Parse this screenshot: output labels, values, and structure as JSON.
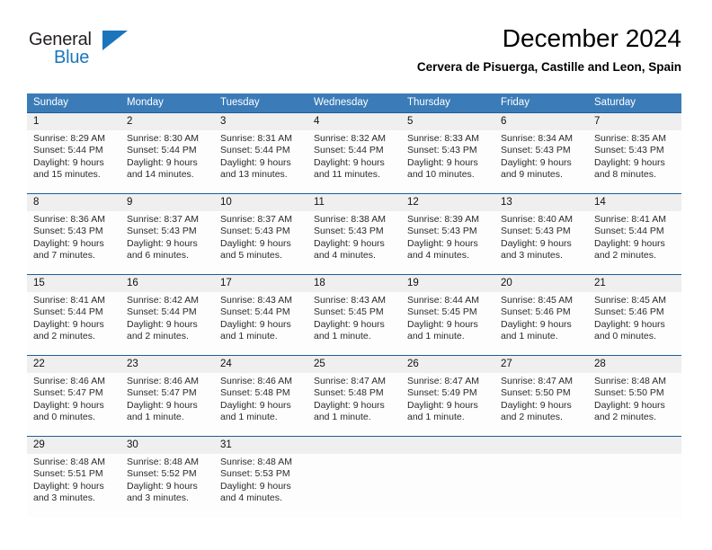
{
  "brand": {
    "name_part1": "General",
    "name_part2": "Blue",
    "flag_icon": "triangle-flag-icon",
    "accent_color": "#1b75bb"
  },
  "header": {
    "title": "December 2024",
    "subtitle": "Cervera de Pisuerga, Castille and Leon, Spain"
  },
  "theme": {
    "header_row_color": "#3b7cb8",
    "row_divider_color": "#1b5e9e",
    "daynum_band_color": "#efefef"
  },
  "calendar": {
    "weekday_headers": [
      "Sunday",
      "Monday",
      "Tuesday",
      "Wednesday",
      "Thursday",
      "Friday",
      "Saturday"
    ],
    "weeks": [
      [
        {
          "day": "1",
          "sunrise": "Sunrise: 8:29 AM",
          "sunset": "Sunset: 5:44 PM",
          "daylight_line1": "Daylight: 9 hours",
          "daylight_line2": "and 15 minutes."
        },
        {
          "day": "2",
          "sunrise": "Sunrise: 8:30 AM",
          "sunset": "Sunset: 5:44 PM",
          "daylight_line1": "Daylight: 9 hours",
          "daylight_line2": "and 14 minutes."
        },
        {
          "day": "3",
          "sunrise": "Sunrise: 8:31 AM",
          "sunset": "Sunset: 5:44 PM",
          "daylight_line1": "Daylight: 9 hours",
          "daylight_line2": "and 13 minutes."
        },
        {
          "day": "4",
          "sunrise": "Sunrise: 8:32 AM",
          "sunset": "Sunset: 5:44 PM",
          "daylight_line1": "Daylight: 9 hours",
          "daylight_line2": "and 11 minutes."
        },
        {
          "day": "5",
          "sunrise": "Sunrise: 8:33 AM",
          "sunset": "Sunset: 5:43 PM",
          "daylight_line1": "Daylight: 9 hours",
          "daylight_line2": "and 10 minutes."
        },
        {
          "day": "6",
          "sunrise": "Sunrise: 8:34 AM",
          "sunset": "Sunset: 5:43 PM",
          "daylight_line1": "Daylight: 9 hours",
          "daylight_line2": "and 9 minutes."
        },
        {
          "day": "7",
          "sunrise": "Sunrise: 8:35 AM",
          "sunset": "Sunset: 5:43 PM",
          "daylight_line1": "Daylight: 9 hours",
          "daylight_line2": "and 8 minutes."
        }
      ],
      [
        {
          "day": "8",
          "sunrise": "Sunrise: 8:36 AM",
          "sunset": "Sunset: 5:43 PM",
          "daylight_line1": "Daylight: 9 hours",
          "daylight_line2": "and 7 minutes."
        },
        {
          "day": "9",
          "sunrise": "Sunrise: 8:37 AM",
          "sunset": "Sunset: 5:43 PM",
          "daylight_line1": "Daylight: 9 hours",
          "daylight_line2": "and 6 minutes."
        },
        {
          "day": "10",
          "sunrise": "Sunrise: 8:37 AM",
          "sunset": "Sunset: 5:43 PM",
          "daylight_line1": "Daylight: 9 hours",
          "daylight_line2": "and 5 minutes."
        },
        {
          "day": "11",
          "sunrise": "Sunrise: 8:38 AM",
          "sunset": "Sunset: 5:43 PM",
          "daylight_line1": "Daylight: 9 hours",
          "daylight_line2": "and 4 minutes."
        },
        {
          "day": "12",
          "sunrise": "Sunrise: 8:39 AM",
          "sunset": "Sunset: 5:43 PM",
          "daylight_line1": "Daylight: 9 hours",
          "daylight_line2": "and 4 minutes."
        },
        {
          "day": "13",
          "sunrise": "Sunrise: 8:40 AM",
          "sunset": "Sunset: 5:43 PM",
          "daylight_line1": "Daylight: 9 hours",
          "daylight_line2": "and 3 minutes."
        },
        {
          "day": "14",
          "sunrise": "Sunrise: 8:41 AM",
          "sunset": "Sunset: 5:44 PM",
          "daylight_line1": "Daylight: 9 hours",
          "daylight_line2": "and 2 minutes."
        }
      ],
      [
        {
          "day": "15",
          "sunrise": "Sunrise: 8:41 AM",
          "sunset": "Sunset: 5:44 PM",
          "daylight_line1": "Daylight: 9 hours",
          "daylight_line2": "and 2 minutes."
        },
        {
          "day": "16",
          "sunrise": "Sunrise: 8:42 AM",
          "sunset": "Sunset: 5:44 PM",
          "daylight_line1": "Daylight: 9 hours",
          "daylight_line2": "and 2 minutes."
        },
        {
          "day": "17",
          "sunrise": "Sunrise: 8:43 AM",
          "sunset": "Sunset: 5:44 PM",
          "daylight_line1": "Daylight: 9 hours",
          "daylight_line2": "and 1 minute."
        },
        {
          "day": "18",
          "sunrise": "Sunrise: 8:43 AM",
          "sunset": "Sunset: 5:45 PM",
          "daylight_line1": "Daylight: 9 hours",
          "daylight_line2": "and 1 minute."
        },
        {
          "day": "19",
          "sunrise": "Sunrise: 8:44 AM",
          "sunset": "Sunset: 5:45 PM",
          "daylight_line1": "Daylight: 9 hours",
          "daylight_line2": "and 1 minute."
        },
        {
          "day": "20",
          "sunrise": "Sunrise: 8:45 AM",
          "sunset": "Sunset: 5:46 PM",
          "daylight_line1": "Daylight: 9 hours",
          "daylight_line2": "and 1 minute."
        },
        {
          "day": "21",
          "sunrise": "Sunrise: 8:45 AM",
          "sunset": "Sunset: 5:46 PM",
          "daylight_line1": "Daylight: 9 hours",
          "daylight_line2": "and 0 minutes."
        }
      ],
      [
        {
          "day": "22",
          "sunrise": "Sunrise: 8:46 AM",
          "sunset": "Sunset: 5:47 PM",
          "daylight_line1": "Daylight: 9 hours",
          "daylight_line2": "and 0 minutes."
        },
        {
          "day": "23",
          "sunrise": "Sunrise: 8:46 AM",
          "sunset": "Sunset: 5:47 PM",
          "daylight_line1": "Daylight: 9 hours",
          "daylight_line2": "and 1 minute."
        },
        {
          "day": "24",
          "sunrise": "Sunrise: 8:46 AM",
          "sunset": "Sunset: 5:48 PM",
          "daylight_line1": "Daylight: 9 hours",
          "daylight_line2": "and 1 minute."
        },
        {
          "day": "25",
          "sunrise": "Sunrise: 8:47 AM",
          "sunset": "Sunset: 5:48 PM",
          "daylight_line1": "Daylight: 9 hours",
          "daylight_line2": "and 1 minute."
        },
        {
          "day": "26",
          "sunrise": "Sunrise: 8:47 AM",
          "sunset": "Sunset: 5:49 PM",
          "daylight_line1": "Daylight: 9 hours",
          "daylight_line2": "and 1 minute."
        },
        {
          "day": "27",
          "sunrise": "Sunrise: 8:47 AM",
          "sunset": "Sunset: 5:50 PM",
          "daylight_line1": "Daylight: 9 hours",
          "daylight_line2": "and 2 minutes."
        },
        {
          "day": "28",
          "sunrise": "Sunrise: 8:48 AM",
          "sunset": "Sunset: 5:50 PM",
          "daylight_line1": "Daylight: 9 hours",
          "daylight_line2": "and 2 minutes."
        }
      ],
      [
        {
          "day": "29",
          "sunrise": "Sunrise: 8:48 AM",
          "sunset": "Sunset: 5:51 PM",
          "daylight_line1": "Daylight: 9 hours",
          "daylight_line2": "and 3 minutes."
        },
        {
          "day": "30",
          "sunrise": "Sunrise: 8:48 AM",
          "sunset": "Sunset: 5:52 PM",
          "daylight_line1": "Daylight: 9 hours",
          "daylight_line2": "and 3 minutes."
        },
        {
          "day": "31",
          "sunrise": "Sunrise: 8:48 AM",
          "sunset": "Sunset: 5:53 PM",
          "daylight_line1": "Daylight: 9 hours",
          "daylight_line2": "and 4 minutes."
        },
        {
          "day": "",
          "sunrise": "",
          "sunset": "",
          "daylight_line1": "",
          "daylight_line2": ""
        },
        {
          "day": "",
          "sunrise": "",
          "sunset": "",
          "daylight_line1": "",
          "daylight_line2": ""
        },
        {
          "day": "",
          "sunrise": "",
          "sunset": "",
          "daylight_line1": "",
          "daylight_line2": ""
        },
        {
          "day": "",
          "sunrise": "",
          "sunset": "",
          "daylight_line1": "",
          "daylight_line2": ""
        }
      ]
    ]
  }
}
